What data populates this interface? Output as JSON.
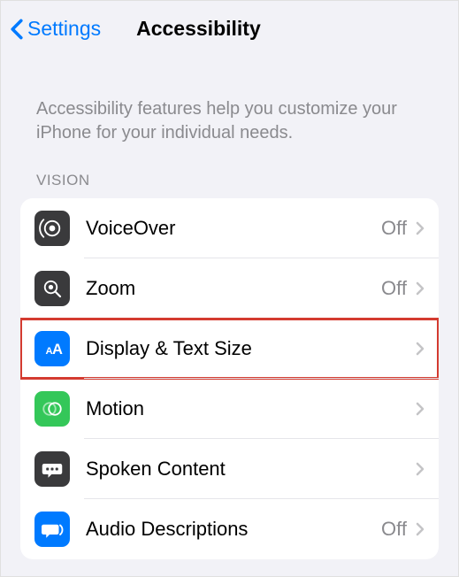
{
  "nav": {
    "back_label": "Settings",
    "title": "Accessibility"
  },
  "description": "Accessibility features help you customize your iPhone for your individual needs.",
  "sections": {
    "vision": {
      "header": "VISION",
      "items": [
        {
          "id": "voiceover",
          "label": "VoiceOver",
          "value": "Off",
          "icon": "voiceover-icon",
          "icon_bg": "#3a3a3c",
          "highlighted": false
        },
        {
          "id": "zoom",
          "label": "Zoom",
          "value": "Off",
          "icon": "zoom-icon",
          "icon_bg": "#3a3a3c",
          "highlighted": false
        },
        {
          "id": "display-text-size",
          "label": "Display & Text Size",
          "value": "",
          "icon": "text-size-icon",
          "icon_bg": "#007aff",
          "highlighted": true
        },
        {
          "id": "motion",
          "label": "Motion",
          "value": "",
          "icon": "motion-icon",
          "icon_bg": "#34c759",
          "highlighted": false
        },
        {
          "id": "spoken-content",
          "label": "Spoken Content",
          "value": "",
          "icon": "spoken-content-icon",
          "icon_bg": "#3a3a3c",
          "highlighted": false
        },
        {
          "id": "audio-descriptions",
          "label": "Audio Descriptions",
          "value": "Off",
          "icon": "audio-descriptions-icon",
          "icon_bg": "#007aff",
          "highlighted": false
        }
      ]
    }
  }
}
